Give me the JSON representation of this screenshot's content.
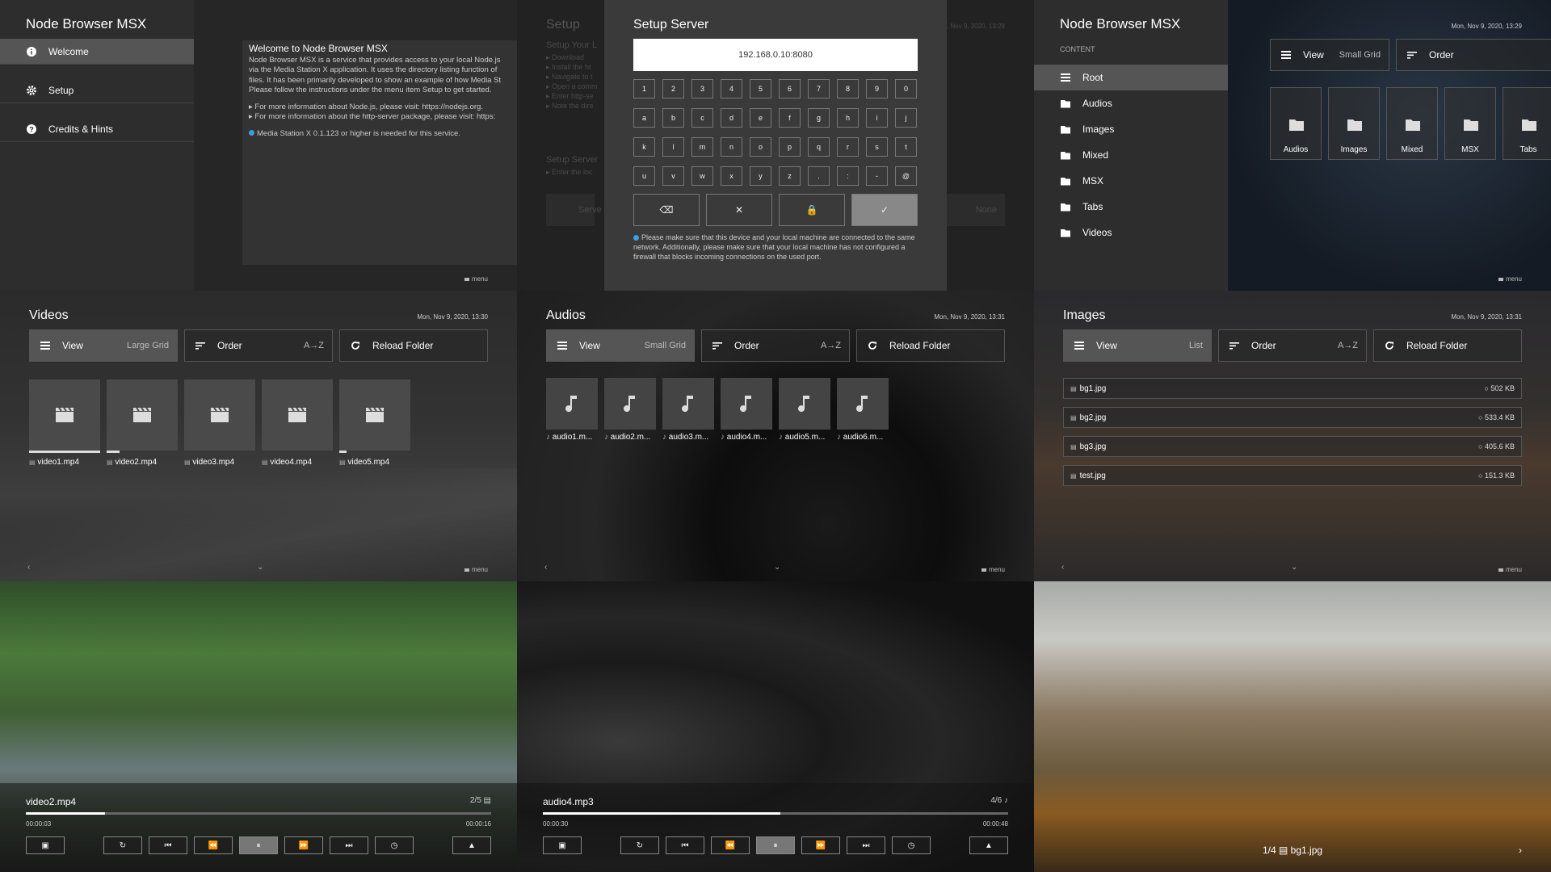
{
  "welcome": {
    "app_title": "Node Browser MSX",
    "menu": [
      {
        "label": "Welcome",
        "icon": "info-icon"
      },
      {
        "label": "Setup",
        "icon": "gear-icon"
      },
      {
        "label": "Credits & Hints",
        "icon": "help-icon"
      }
    ],
    "content_title": "Welcome to Node Browser MSX",
    "lines": [
      "Node Browser MSX is a service that provides access to your local Node.js",
      "via the Media Station X application. It uses the directory listing function of",
      "files. It has been primarily developed to show an example of how Media St",
      "Please follow the instructions under the menu item Setup to get started."
    ],
    "info1": "▸ For more information about Node.js, please visit: https://nodejs.org.",
    "info2": "▸ For more information about the http-server package, please visit: https:",
    "requirement": "Media Station X 0.1.123 or higher is needed for this service.",
    "menu_hint": "menu"
  },
  "setup": {
    "bg_title": "Setup",
    "bg_lines": [
      "Setup Your L",
      "▸ Download",
      "▸ Install the ht",
      "▸ Navigate to t",
      "▸ Open a comm",
      "▸ Enter http-se",
      "▸ Note the dire"
    ],
    "bg_title2": "Setup Server",
    "bg_line2": "▸ Enter the loc",
    "bg_field": "Serve",
    "bg_none": "None",
    "bg_date": "Mon, Nov 9, 2020, 13:28",
    "dialog_title": "Setup Server",
    "ip_value": "192.168.0.10:8080",
    "keys": [
      [
        "1",
        "2",
        "3",
        "4",
        "5",
        "6",
        "7",
        "8",
        "9",
        "0"
      ],
      [
        "a",
        "b",
        "c",
        "d",
        "e",
        "f",
        "g",
        "h",
        "i",
        "j"
      ],
      [
        "k",
        "l",
        "m",
        "n",
        "o",
        "p",
        "q",
        "r",
        "s",
        "t"
      ],
      [
        "u",
        "v",
        "w",
        "x",
        "y",
        "z",
        ".",
        ":",
        "-",
        "@"
      ]
    ],
    "action_keys": [
      {
        "name": "backspace-key",
        "glyph": "⌫"
      },
      {
        "name": "clear-key",
        "glyph": "✕"
      },
      {
        "name": "lock-key",
        "glyph": "🔒"
      },
      {
        "name": "confirm-key",
        "glyph": "✓"
      }
    ],
    "note": "Please make sure that this device and your local machine are connected to the same network. Additionally, please make sure that your local machine has not configured a firewall that blocks incoming connections on the used port.",
    "menu_hint": "menu"
  },
  "root": {
    "app_title": "Node Browser MSX",
    "caption": "CONTENT",
    "items": [
      "Root",
      "Audios",
      "Images",
      "Mixed",
      "MSX",
      "Tabs",
      "Videos"
    ],
    "date": "Mon, Nov 9, 2020, 13:29",
    "view_label": "View",
    "view_value": "Small Grid",
    "order_label": "Order",
    "tiles": [
      "Audios",
      "Images",
      "Mixed",
      "MSX",
      "Tabs"
    ],
    "menu_hint": "menu"
  },
  "videos": {
    "title": "Videos",
    "date": "Mon, Nov 9, 2020, 13:30",
    "view_label": "View",
    "view_value": "Large Grid",
    "order_label": "Order",
    "order_value": "A→Z",
    "reload_label": "Reload Folder",
    "files": [
      "video1.mp4",
      "video2.mp4",
      "video3.mp4",
      "video4.mp4",
      "video5.mp4"
    ],
    "progress": [
      1.0,
      0.18,
      0.0,
      0.0,
      0.1
    ],
    "menu_hint": "menu"
  },
  "audios": {
    "title": "Audios",
    "date": "Mon, Nov 9, 2020, 13:31",
    "view_label": "View",
    "view_value": "Small Grid",
    "order_label": "Order",
    "order_value": "A→Z",
    "reload_label": "Reload Folder",
    "files": [
      "audio1.m...",
      "audio2.m...",
      "audio3.m...",
      "audio4.m...",
      "audio5.m...",
      "audio6.m..."
    ],
    "menu_hint": "menu"
  },
  "images": {
    "title": "Images",
    "date": "Mon, Nov 9, 2020, 13:31",
    "view_label": "View",
    "view_value": "List",
    "order_label": "Order",
    "order_value": "A→Z",
    "reload_label": "Reload Folder",
    "files": [
      {
        "name": "bg1.jpg",
        "size": "502 KB"
      },
      {
        "name": "bg2.jpg",
        "size": "533.4 KB"
      },
      {
        "name": "bg3.jpg",
        "size": "405.6 KB"
      },
      {
        "name": "test.jpg",
        "size": "151.3 KB"
      }
    ],
    "menu_hint": "menu"
  },
  "video_player": {
    "file": "video2.mp4",
    "count": "2/5",
    "elapsed": "00:00:03",
    "duration": "00:00:16",
    "progress": 0.17
  },
  "audio_player": {
    "file": "audio4.mp3",
    "count": "4/6",
    "elapsed": "00:00:30",
    "duration": "00:00:48",
    "progress": 0.51
  },
  "image_viewer": {
    "caption": "1/4",
    "file": "bg1.jpg"
  }
}
